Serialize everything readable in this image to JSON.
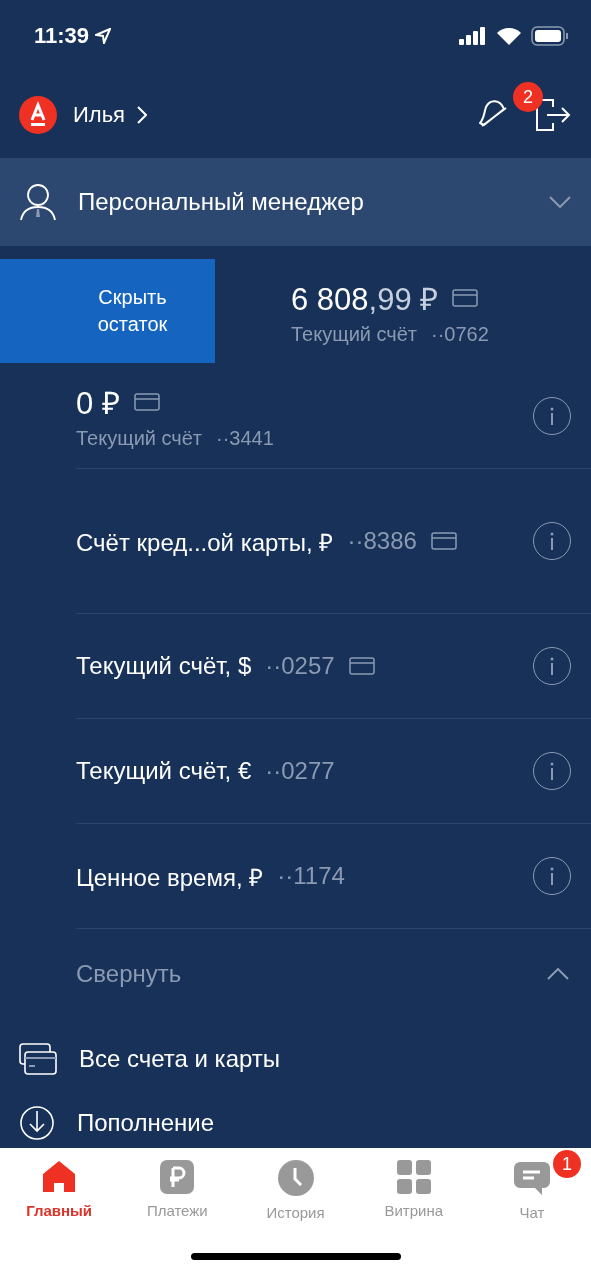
{
  "status_bar": {
    "time": "11:39"
  },
  "header": {
    "user": "Илья",
    "notifications": "2"
  },
  "manager": {
    "label": "Персональный менеджер",
    "expanded": false
  },
  "hide_balance_button": "Скрыть остаток",
  "accounts": [
    {
      "kind": "balance",
      "amount": "6 808",
      "fraction": ",99 ₽",
      "label": "Текущий счёт",
      "number": "··0762",
      "card": true,
      "info": false
    },
    {
      "kind": "balance",
      "amount": "0 ₽",
      "label": "Текущий счёт",
      "number": "··3441",
      "card": true,
      "info": true
    },
    {
      "kind": "named",
      "label": "Счёт кред...ой карты, ₽",
      "number": "··8386",
      "card": true,
      "info": true
    },
    {
      "kind": "named",
      "label": "Текущий счёт, $",
      "number": "··0257",
      "card": true,
      "info": true
    },
    {
      "kind": "named",
      "label": "Текущий счёт, €",
      "number": "··0277",
      "card": false,
      "info": true
    },
    {
      "kind": "named",
      "label": "Ценное время, ₽",
      "number": "··1174",
      "card": false,
      "info": true
    }
  ],
  "collapse": "Свернуть",
  "menu": [
    {
      "kind": "cards",
      "label": "Все счета и карты"
    },
    {
      "kind": "topup",
      "label": "Пополнение"
    }
  ],
  "tabs": [
    {
      "kind": "home",
      "label": "Главный",
      "selected": true
    },
    {
      "kind": "payments",
      "label": "Платежи",
      "selected": false
    },
    {
      "kind": "history",
      "label": "История",
      "selected": false
    },
    {
      "kind": "showcase",
      "label": "Витрина",
      "selected": false
    },
    {
      "kind": "chat",
      "label": "Чат",
      "selected": false,
      "badge": "1"
    }
  ]
}
